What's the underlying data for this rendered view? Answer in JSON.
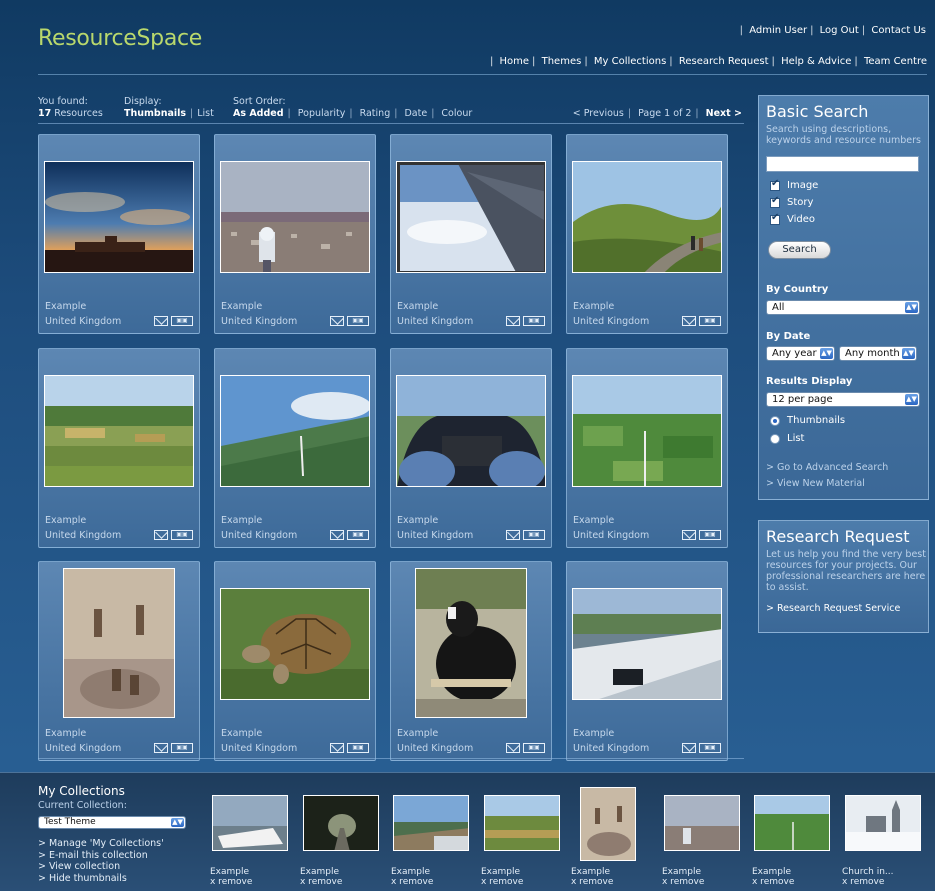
{
  "app": {
    "logo": "ResourceSpace",
    "brand_color": "#b9d86c",
    "accent_color": "#2a66c2"
  },
  "toplinks": [
    "Admin User",
    "Log Out",
    "Contact Us"
  ],
  "mainnav": [
    "Home",
    "Themes",
    "My Collections",
    "Research Request",
    "Help & Advice",
    "Team Centre"
  ],
  "results": {
    "found_label": "You found:",
    "count": "17",
    "count_suffix": "Resources",
    "display_label": "Display:",
    "display_options": [
      "Thumbnails",
      "List"
    ],
    "display_selected": "Thumbnails",
    "sort_label": "Sort Order:",
    "sort_options": [
      "As Added",
      "Popularity",
      "Rating",
      "Date",
      "Colour"
    ],
    "sort_selected": "As Added",
    "pager": {
      "previous": "< Previous",
      "page_text": "Page 1 of 2",
      "next": "Next >"
    }
  },
  "resources": [
    {
      "title": "Example",
      "country": "United Kingdom",
      "image": "sunset-building"
    },
    {
      "title": "Example",
      "country": "United Kingdom",
      "image": "binoculars-town"
    },
    {
      "title": "Example",
      "country": "United Kingdom",
      "image": "plane-wing-clouds"
    },
    {
      "title": "Example",
      "country": "United Kingdom",
      "image": "green-hill-path"
    },
    {
      "title": "Example",
      "country": "United Kingdom",
      "image": "hill-fields"
    },
    {
      "title": "Example",
      "country": "United Kingdom",
      "image": "aerial-view"
    },
    {
      "title": "Example",
      "country": "United Kingdom",
      "image": "glider-cockpit"
    },
    {
      "title": "Example",
      "country": "United Kingdom",
      "image": "aerial-fields"
    },
    {
      "title": "Example",
      "country": "United Kingdom",
      "image": "meerkats"
    },
    {
      "title": "Example",
      "country": "United Kingdom",
      "image": "tortoise"
    },
    {
      "title": "Example",
      "country": "United Kingdom",
      "image": "dogs"
    },
    {
      "title": "Example",
      "country": "United Kingdom",
      "image": "boat"
    }
  ],
  "icons": {
    "email": "email-icon",
    "add_to_collection": "add-to-collection-icon",
    "select_arrow": "select-arrow-icon"
  },
  "basic_search": {
    "title": "Basic Search",
    "description": "Search using descriptions, keywords and resource numbers",
    "query_value": "",
    "types": [
      {
        "label": "Image",
        "checked": true
      },
      {
        "label": "Story",
        "checked": true
      },
      {
        "label": "Video",
        "checked": true
      }
    ],
    "search_button": "Search",
    "country_label": "By Country",
    "country_value": "All",
    "date_label": "By Date",
    "year_value": "Any year",
    "month_value": "Any month",
    "results_display_label": "Results Display",
    "per_page_value": "12 per page",
    "display_radios": [
      {
        "label": "Thumbnails",
        "selected": true
      },
      {
        "label": "List",
        "selected": false
      }
    ],
    "advanced_link": "> Go to Advanced Search",
    "new_material_link": "> View New Material"
  },
  "research_request": {
    "title": "Research Request",
    "description": "Let us help you find the very best resources for your projects. Our professional researchers are here to assist.",
    "link": "> Research Request Service"
  },
  "my_collections": {
    "title": "My Collections",
    "current_label": "Current Collection:",
    "current_value": "Test Theme",
    "links": [
      "> Manage 'My Collections'",
      "> E-mail this collection",
      "> View collection",
      "> Hide thumbnails"
    ],
    "items": [
      {
        "title": "Example",
        "action": "x remove",
        "image": "boat"
      },
      {
        "title": "Example",
        "action": "x remove",
        "image": "dark-path"
      },
      {
        "title": "Example",
        "action": "x remove",
        "image": "coast"
      },
      {
        "title": "Example",
        "action": "x remove",
        "image": "hill-fields"
      },
      {
        "title": "Example",
        "action": "x remove",
        "image": "meerkats"
      },
      {
        "title": "Example",
        "action": "x remove",
        "image": "binoculars-town"
      },
      {
        "title": "Example",
        "action": "x remove",
        "image": "aerial-fields"
      },
      {
        "title": "Church in...",
        "action": "x remove",
        "image": "snow-church"
      }
    ]
  }
}
